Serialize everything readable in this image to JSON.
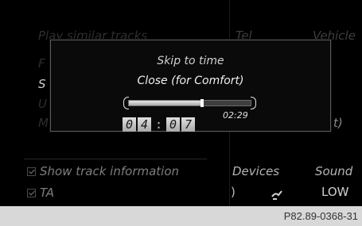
{
  "background": {
    "left_menu": [
      {
        "label": "Play similar tracks"
      },
      {
        "label": "F"
      },
      {
        "label": "S"
      },
      {
        "label": "U"
      },
      {
        "label": "M"
      }
    ],
    "right_menu": {
      "tel_label": "Tel",
      "vehicle_label": "Vehicle",
      "partial_text": "t)"
    },
    "bottom_left": {
      "show_track_info": "Show track information",
      "ta": "TA"
    },
    "bottom_right": {
      "devices": "Devices",
      "sound": "Sound",
      "level": "LOW"
    }
  },
  "dialog": {
    "title": "Skip to time",
    "track_name": "Close (for Comfort)",
    "elapsed": "02:29",
    "progress_fraction": 0.6,
    "time_digits": [
      "0",
      "4",
      "0",
      "7"
    ],
    "separator": ":"
  },
  "caption": "P82.89-0368-31"
}
